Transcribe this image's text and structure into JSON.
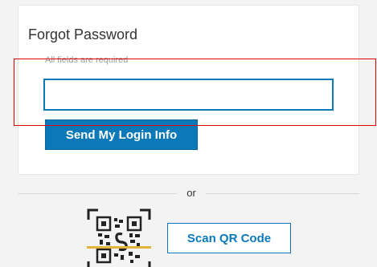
{
  "form": {
    "title": "Forgot Password",
    "required_note": "All fields are required",
    "input_value": "",
    "send_button_label": "Send My Login Info"
  },
  "divider": {
    "label": "or"
  },
  "qr": {
    "icon": "qr-code-icon",
    "scan_button_label": "Scan QR Code"
  },
  "colors": {
    "accent": "#0b79b8",
    "highlight": "#e00000",
    "background": "#f3f3f3"
  }
}
